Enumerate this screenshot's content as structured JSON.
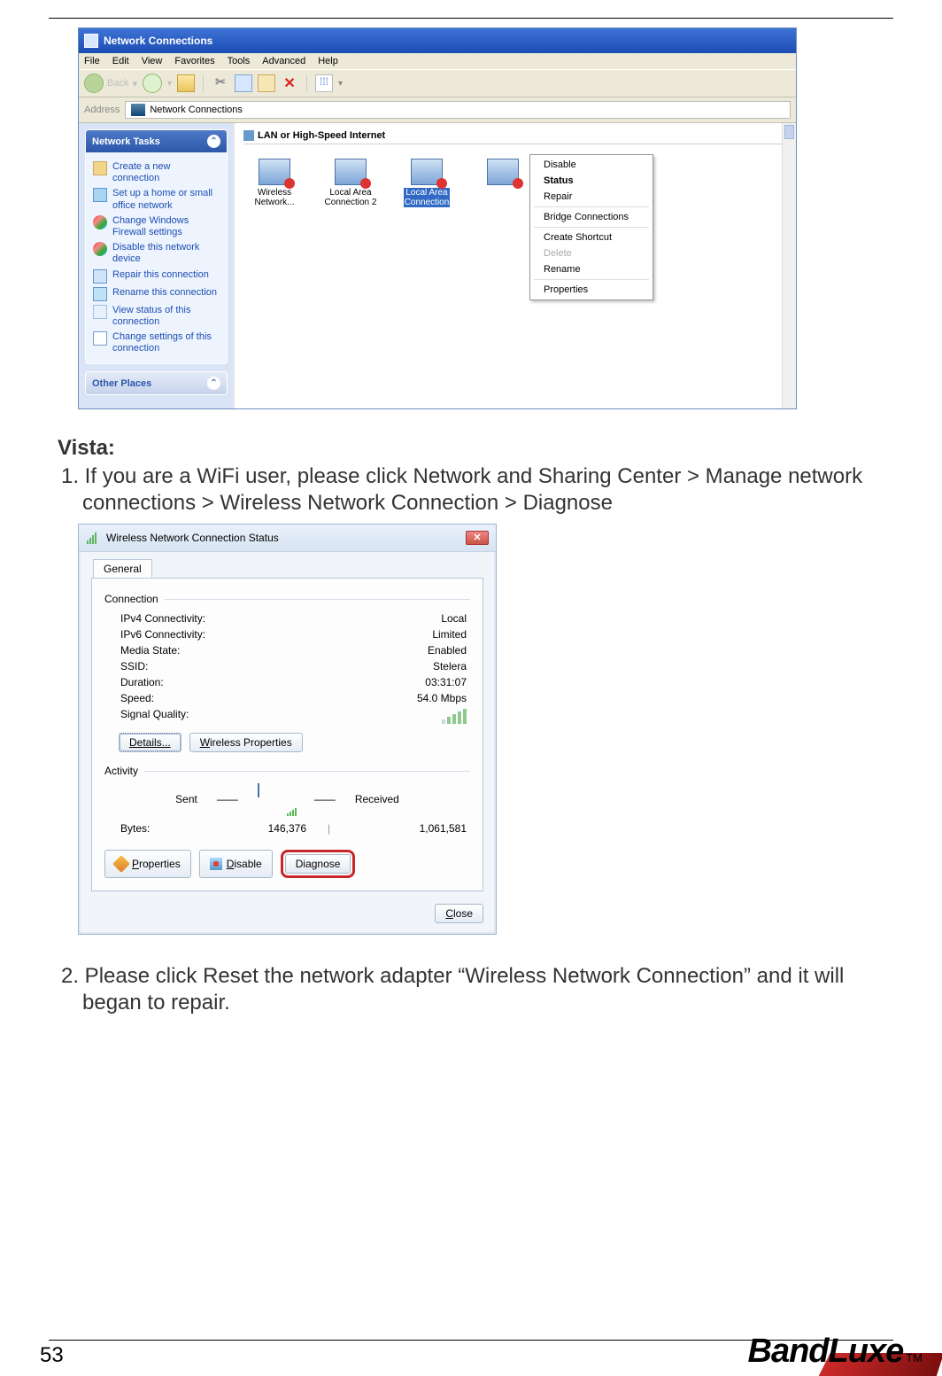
{
  "rule_present": true,
  "xp_window": {
    "title": "Network Connections",
    "menu": [
      "File",
      "Edit",
      "View",
      "Favorites",
      "Tools",
      "Advanced",
      "Help"
    ],
    "toolbar": {
      "back_label": "Back",
      "views_glyph": "⁞⁞⁞"
    },
    "address": {
      "label": "Address",
      "value": "Network Connections"
    },
    "sidebar": {
      "panel1_title": "Network Tasks",
      "items": [
        "Create a new connection",
        "Set up a home or small office network",
        "Change Windows Firewall settings",
        "Disable this network device",
        "Repair this connection",
        "Rename this connection",
        "View status of this connection",
        "Change settings of this connection"
      ],
      "panel2_title": "Other Places"
    },
    "main": {
      "category": "LAN or High-Speed Internet",
      "icons": [
        {
          "label": "Wireless\nNetwork..."
        },
        {
          "label": "Local Area\nConnection 2"
        },
        {
          "label": "Local Area\nConnection",
          "selected": true
        },
        {
          "label": ""
        }
      ],
      "context_menu": [
        {
          "label": "Disable"
        },
        {
          "label": "Status",
          "bold": true
        },
        {
          "label": "Repair"
        },
        {
          "sep": true
        },
        {
          "label": "Bridge Connections"
        },
        {
          "sep": true
        },
        {
          "label": "Create Shortcut"
        },
        {
          "label": "Delete",
          "disabled": true
        },
        {
          "label": "Rename"
        },
        {
          "sep": true
        },
        {
          "label": "Properties"
        }
      ]
    }
  },
  "doc": {
    "heading": "Vista:",
    "step1": "1. If you are a WiFi user, please click Network and Sharing Center > Manage network connections > Wireless Network Connection > Diagnose",
    "step2": "2. Please click Reset the network adapter “Wireless Network Connection” and it will began to repair."
  },
  "vista_dialog": {
    "title": "Wireless Network Connection Status",
    "close_glyph": "✕",
    "tab": "General",
    "group_connection": "Connection",
    "rows": [
      {
        "k": "IPv4 Connectivity:",
        "v": "Local"
      },
      {
        "k": "IPv6 Connectivity:",
        "v": "Limited"
      },
      {
        "k": "Media State:",
        "v": "Enabled"
      },
      {
        "k": "SSID:",
        "v": "Stelera"
      },
      {
        "k": "Duration:",
        "v": "03:31:07"
      },
      {
        "k": "Speed:",
        "v": "54.0 Mbps"
      }
    ],
    "signal_label": "Signal Quality:",
    "btn_details": "Details...",
    "btn_wprops": "Wireless Properties",
    "group_activity": "Activity",
    "sent_label": "Sent",
    "received_label": "Received",
    "bytes_label": "Bytes:",
    "bytes_sent": "146,376",
    "bytes_recv": "1,061,581",
    "btn_properties": "Properties",
    "btn_disable": "Disable",
    "btn_diagnose": "Diagnose",
    "btn_close": "Close"
  },
  "footer": {
    "page": "53",
    "brand": "BandLuxe",
    "tm": "TM"
  }
}
